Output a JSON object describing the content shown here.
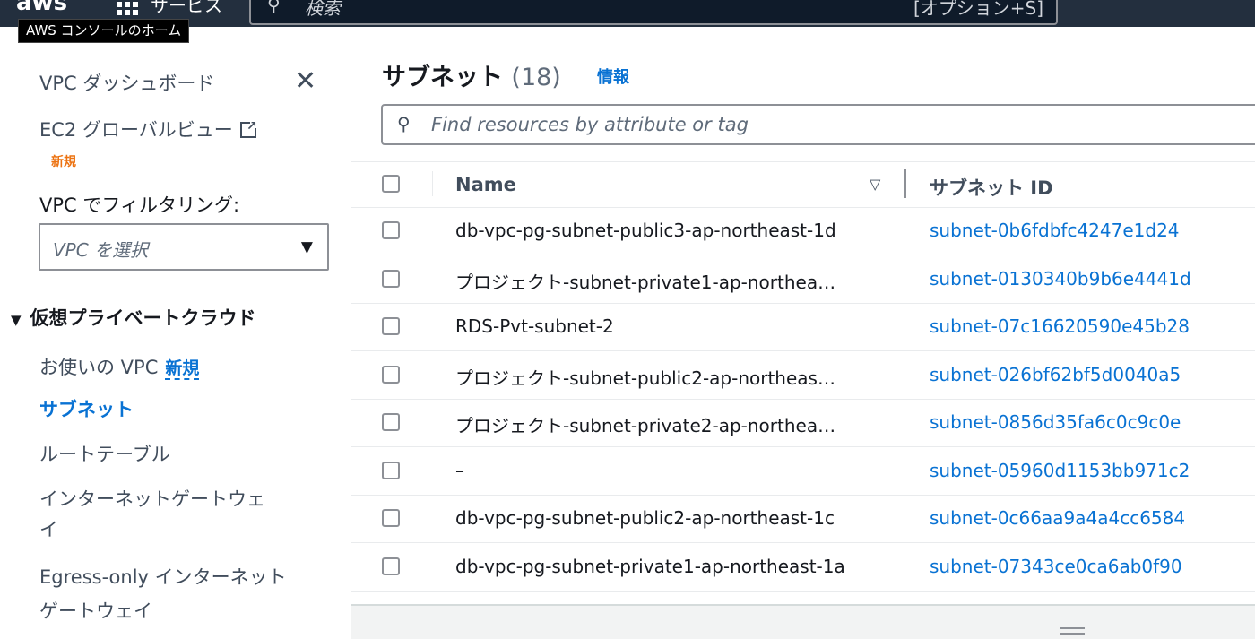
{
  "header": {
    "logo": "aws",
    "services_label": "サービス",
    "search_placeholder": "検索",
    "search_shortcut": "[オプション+S]",
    "tooltip": "AWS コンソールのホーム"
  },
  "sidebar": {
    "dashboard": "VPC ダッシュボード",
    "ec2_global": "EC2 グローバルビュー",
    "ec2_global_badge": "新規",
    "filter_label": "VPC でフィルタリング:",
    "filter_placeholder": "VPC を選択",
    "section_title": "仮想プライベートクラウド",
    "your_vpcs": "お使いの VPC",
    "your_vpcs_badge": "新規",
    "subnets": "サブネット",
    "route_tables": "ルートテーブル",
    "igw_line1": "インターネットゲートウェ",
    "igw_line2": "イ",
    "egress_line1": "Egress-only インターネット",
    "egress_line2": "ゲートウェイ"
  },
  "main": {
    "title": "サブネット",
    "count": "(18)",
    "info_link": "情報",
    "filter_placeholder": "Find resources by attribute or tag",
    "columns": {
      "name": "Name",
      "subnet_id": "サブネット ID"
    },
    "rows": [
      {
        "name": "db-vpc-pg-subnet-public3-ap-northeast-1d",
        "id": "subnet-0b6fdbfc4247e1d24"
      },
      {
        "name": "プロジェクト-subnet-private1-ap-northea…",
        "id": "subnet-0130340b9b6e4441d"
      },
      {
        "name": "RDS-Pvt-subnet-2",
        "id": "subnet-07c16620590e45b28"
      },
      {
        "name": "プロジェクト-subnet-public2-ap-northeas…",
        "id": "subnet-026bf62bf5d0040a5"
      },
      {
        "name": "プロジェクト-subnet-private2-ap-northea…",
        "id": "subnet-0856d35fa6c0c9c0e"
      },
      {
        "name": "–",
        "id": "subnet-05960d1153bb971c2"
      },
      {
        "name": "db-vpc-pg-subnet-public2-ap-northeast-1c",
        "id": "subnet-0c66aa9a4a4cc6584"
      },
      {
        "name": "db-vpc-pg-subnet-private1-ap-northeast-1a",
        "id": "subnet-07343ce0ca6ab0f90"
      }
    ]
  },
  "colors": {
    "header_bg": "#232f3e",
    "link": "#0972d3",
    "badge_new": "#ec7211"
  },
  "icons": [
    "services-grid-icon",
    "search-icon",
    "close-icon",
    "external-link-icon",
    "caret-down-icon",
    "sort-icon",
    "resize-handle-icon"
  ]
}
